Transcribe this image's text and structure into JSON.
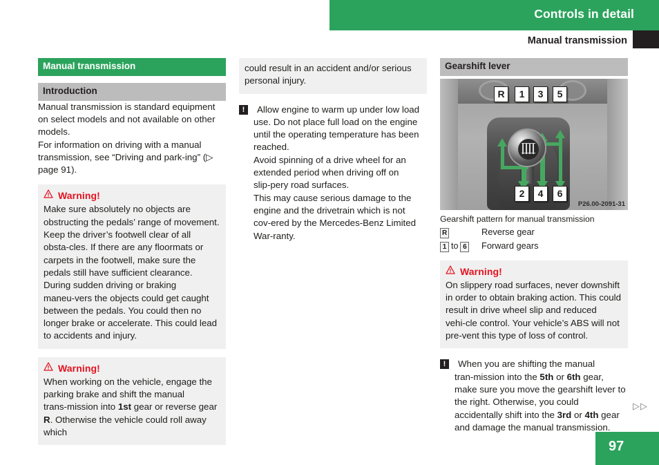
{
  "header": {
    "chapter_title": "Controls in detail",
    "section_title": "Manual transmission"
  },
  "columns": {
    "left": {
      "green_bar": "Manual transmission",
      "grey_bar": "Introduction",
      "paragraph_1": "Manual transmission is standard equipment on select models and not available on other models.",
      "paragraph_2": "For information on driving with a manual transmission, see “Driving and park‑ing” (▷ page 91).",
      "warning_1": {
        "title": "Warning!",
        "icon": "warning-triangle-icon",
        "paragraph_1": "Make sure absolutely no objects are obstructing the pedals’ range of movement. Keep the driver’s footwell clear of all obsta‑cles. If there are any floormats or carpets in the footwell, make sure the pedals still have sufficient clearance.",
        "paragraph_2": "During sudden driving or braking maneu‑vers the objects could get caught between the pedals. You could then no longer brake or accelerate. This could lead to accidents and injury."
      },
      "warning_2": {
        "title": "Warning!",
        "icon": "warning-triangle-icon",
        "paragraph_html": "When working on the vehicle, engage the parking brake and shift the manual trans‑mission into <b>1st</b> gear or reverse gear <b>R</b>. Otherwise the vehicle could roll away which"
      }
    },
    "middle": {
      "warning_continued": "could result in an accident and/or serious personal injury.",
      "notice": {
        "icon": "exclamation-box-icon",
        "icon_glyph": "!",
        "paragraph_1": "Allow engine to warm up under low load use. Do not place full load on the engine until the operating temperature has been reached.",
        "paragraph_2": "Avoid spinning of a drive wheel for an extended period when driving off on slip‑pery road surfaces.",
        "paragraph_3": "This may cause serious damage to the engine and the drivetrain which is not cov‑ered by the Mercedes-Benz Limited War‑ranty."
      }
    },
    "right": {
      "grey_bar": "Gearshift lever",
      "figure": {
        "alt": "gearshift-pattern-photo",
        "code": "P26.00-2091-31",
        "top_labels": [
          "R",
          "1",
          "3",
          "5"
        ],
        "bottom_labels": [
          "2",
          "4",
          "6"
        ]
      },
      "figure_caption": "Gearshift pattern for manual transmission",
      "legend": [
        {
          "keys": [
            "R"
          ],
          "separator": "",
          "text": "Reverse gear"
        },
        {
          "keys": [
            "1",
            "6"
          ],
          "separator": "to",
          "text": "Forward gears"
        }
      ],
      "warning": {
        "title": "Warning!",
        "icon": "warning-triangle-icon",
        "paragraph": "On slippery road surfaces, never downshift in order to obtain braking action. This could result in drive wheel slip and reduced vehi‑cle control. Your vehicle’s ABS will not pre‑vent this type of loss of control."
      },
      "notice": {
        "icon": "exclamation-box-icon",
        "icon_glyph": "!",
        "paragraph_html": "When you are shifting the manual tran‑mission into the <b>5th</b> or <b>6th</b> gear, make sure you move the gearshift lever to the right. Otherwise, you could accidentally shift into the <b>3rd</b> or <b>4th</b> gear and damage the manual transmission."
      }
    }
  },
  "footer": {
    "continuation_marker": "▷▷",
    "page_number": "97"
  },
  "colors": {
    "accent_green": "#2ba35c",
    "warning_red": "#e4121f",
    "grey_bar": "#bcbcbc",
    "warning_box_bg": "#f0f0f0",
    "black": "#231f20",
    "arrow_green": "#46a860"
  }
}
